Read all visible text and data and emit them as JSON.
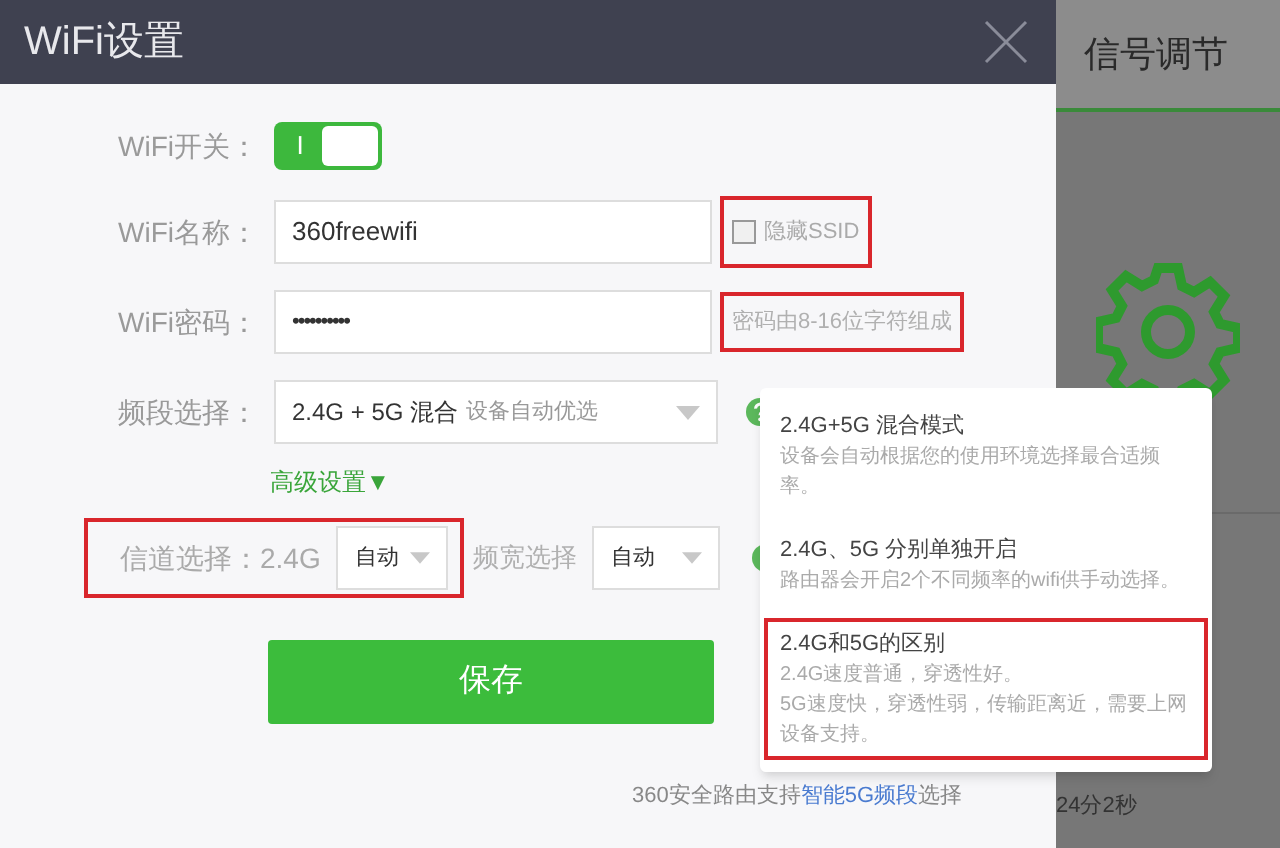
{
  "dialog": {
    "title": "WiFi设置",
    "wifi_switch": {
      "label": "WiFi开关：",
      "on": true,
      "knob_text": "I"
    },
    "ssid": {
      "label": "WiFi名称：",
      "value": "360freewifi",
      "hide_ssid": {
        "label": "隐藏SSID",
        "checked": false,
        "highlighted": true
      }
    },
    "password": {
      "label": "WiFi密码：",
      "value": "••••••••••",
      "hint": {
        "text": "密码由8-16位字符组成",
        "highlighted": true
      }
    },
    "band": {
      "label": "频段选择：",
      "value": "2.4G + 5G 混合",
      "note": "设备自动优选"
    },
    "advanced_link": "高级设置▼",
    "channel": {
      "label": "信道选择：2.4G",
      "value": "自动",
      "highlighted": true
    },
    "bandwidth": {
      "label": "频宽选择",
      "value": "自动"
    },
    "save_button": "保存",
    "footer": {
      "prefix": "360安全路由支持",
      "link": "智能5G频段",
      "suffix": "选择"
    }
  },
  "tooltip": {
    "sections": [
      {
        "title": "2.4G+5G 混合模式",
        "lines": [
          "设备会自动根据您的使用环境选择最合适频率。"
        ],
        "highlighted": false
      },
      {
        "title": "2.4G、5G 分别单独开启",
        "lines": [
          "路由器会开启2个不同频率的wifi供手动选择。"
        ],
        "highlighted": false
      },
      {
        "title": "2.4G和5G的区别",
        "lines": [
          "2.4G速度普通，穿透性好。",
          "5G速度快，穿透性弱，传输距离近，需要上网设备支持。"
        ],
        "highlighted": true
      }
    ]
  },
  "side_panel": {
    "title": "信号调节",
    "status": "24分2秒"
  }
}
